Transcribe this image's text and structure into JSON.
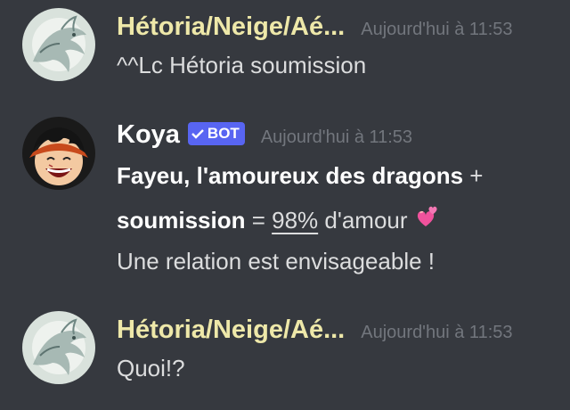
{
  "messages": [
    {
      "username": "Hétoria/Neige/Aé...",
      "timestamp": "Aujourd'hui à 11:53",
      "lines": [
        "^^Lc Hétoria soumission"
      ]
    },
    {
      "username": "Koya",
      "bot_tag": "BOT",
      "timestamp": "Aujourd'hui à 11:53",
      "line1_bold": "Fayeu, l'amoureux des dragons",
      "line1_plus": " +",
      "line2_bold": "soumission",
      "line2_eq": " = ",
      "line2_pct": "98%",
      "line2_rest": " d'amour",
      "line3": "Une relation est envisageable !"
    },
    {
      "username": "Hétoria/Neige/Aé...",
      "timestamp": "Aujourd'hui à 11:53",
      "lines": [
        "Quoi!?"
      ]
    }
  ],
  "icons": {
    "avatar1": "dragon-avatar-icon",
    "avatar2": "luffy-avatar-icon",
    "bot_check": "checkmark-icon",
    "emoji": "two-hearts-emoji-icon"
  },
  "colors": {
    "background": "#36393f",
    "username_yellow": "#eee8a9",
    "bot_tag": "#5865f2",
    "timestamp": "#72767d",
    "text": "#dcddde"
  }
}
